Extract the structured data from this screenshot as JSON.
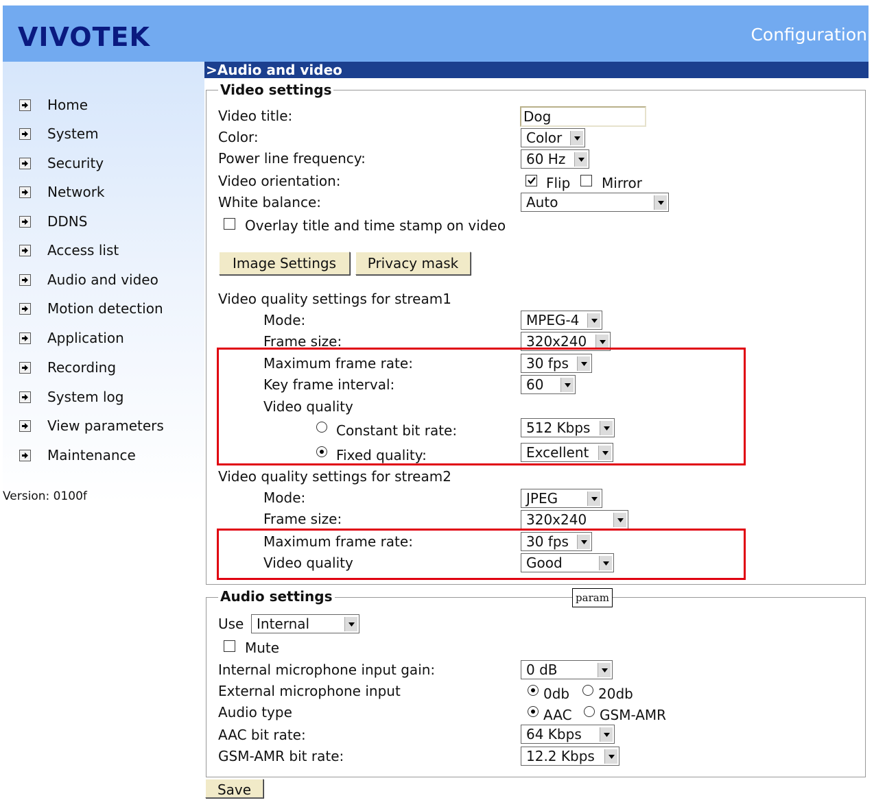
{
  "header": {
    "logo": "VIVOTEK",
    "title": "Configuration"
  },
  "sidebar": {
    "items": [
      {
        "label": "Home"
      },
      {
        "label": "System"
      },
      {
        "label": "Security"
      },
      {
        "label": "Network"
      },
      {
        "label": "DDNS"
      },
      {
        "label": "Access list"
      },
      {
        "label": "Audio and video"
      },
      {
        "label": "Motion detection"
      },
      {
        "label": "Application"
      },
      {
        "label": "Recording"
      },
      {
        "label": "System log"
      },
      {
        "label": "View parameters"
      },
      {
        "label": "Maintenance"
      }
    ],
    "version": "Version: 0100f"
  },
  "section": {
    "title": ">Audio and video"
  },
  "video": {
    "legend": "Video settings",
    "title_label": "Video title:",
    "title_value": "Dog",
    "color_label": "Color:",
    "color_value": "Color",
    "power_label": "Power line frequency:",
    "power_value": "60 Hz",
    "orientation_label": "Video orientation:",
    "flip_label": "Flip",
    "flip_checked": true,
    "mirror_label": "Mirror",
    "mirror_checked": false,
    "wb_label": "White balance:",
    "wb_value": "Auto",
    "overlay_label": "Overlay title and time stamp on video",
    "overlay_checked": false,
    "image_settings_btn": "Image Settings",
    "privacy_mask_btn": "Privacy mask",
    "stream1": {
      "heading": "Video quality settings for stream1",
      "mode_label": "Mode:",
      "mode_value": "MPEG-4",
      "frame_size_label": "Frame size:",
      "frame_size_value": "320x240",
      "max_fr_label": "Maximum frame rate:",
      "max_fr_value": "30 fps",
      "key_label": "Key frame interval:",
      "key_value": "60",
      "vq_label": "Video quality",
      "cbr_label": "Constant bit rate:",
      "cbr_value": "512 Kbps",
      "fixed_label": "Fixed quality:",
      "fixed_value": "Excellent",
      "selected": "fixed"
    },
    "stream2": {
      "heading": "Video quality settings for stream2",
      "mode_label": "Mode:",
      "mode_value": "JPEG",
      "frame_size_label": "Frame size:",
      "frame_size_value": "320x240",
      "max_fr_label": "Maximum frame rate:",
      "max_fr_value": "30 fps",
      "vq_label": "Video quality",
      "vq_value": "Good"
    }
  },
  "audio": {
    "legend": "Audio settings",
    "param_label": "param",
    "use_label": "Use",
    "use_value": "Internal",
    "mute_label": "Mute",
    "mute_checked": false,
    "gain_label": "Internal microphone input gain:",
    "gain_value": "0 dB",
    "ext_label": "External microphone input",
    "ext_opt1": "0db",
    "ext_opt2": "20db",
    "ext_selected": "0db",
    "type_label": "Audio type",
    "type_opt1": "AAC",
    "type_opt2": "GSM-AMR",
    "type_selected": "AAC",
    "aac_label": "AAC bit rate:",
    "aac_value": "64 Kbps",
    "gsm_label": "GSM-AMR bit rate:",
    "gsm_value": "12.2 Kbps"
  },
  "save_btn": "Save",
  "colors": {
    "header": "#72aaf0",
    "section_bar": "#1b3f8e",
    "highlight": "#e00010",
    "button": "#f1eac8"
  }
}
